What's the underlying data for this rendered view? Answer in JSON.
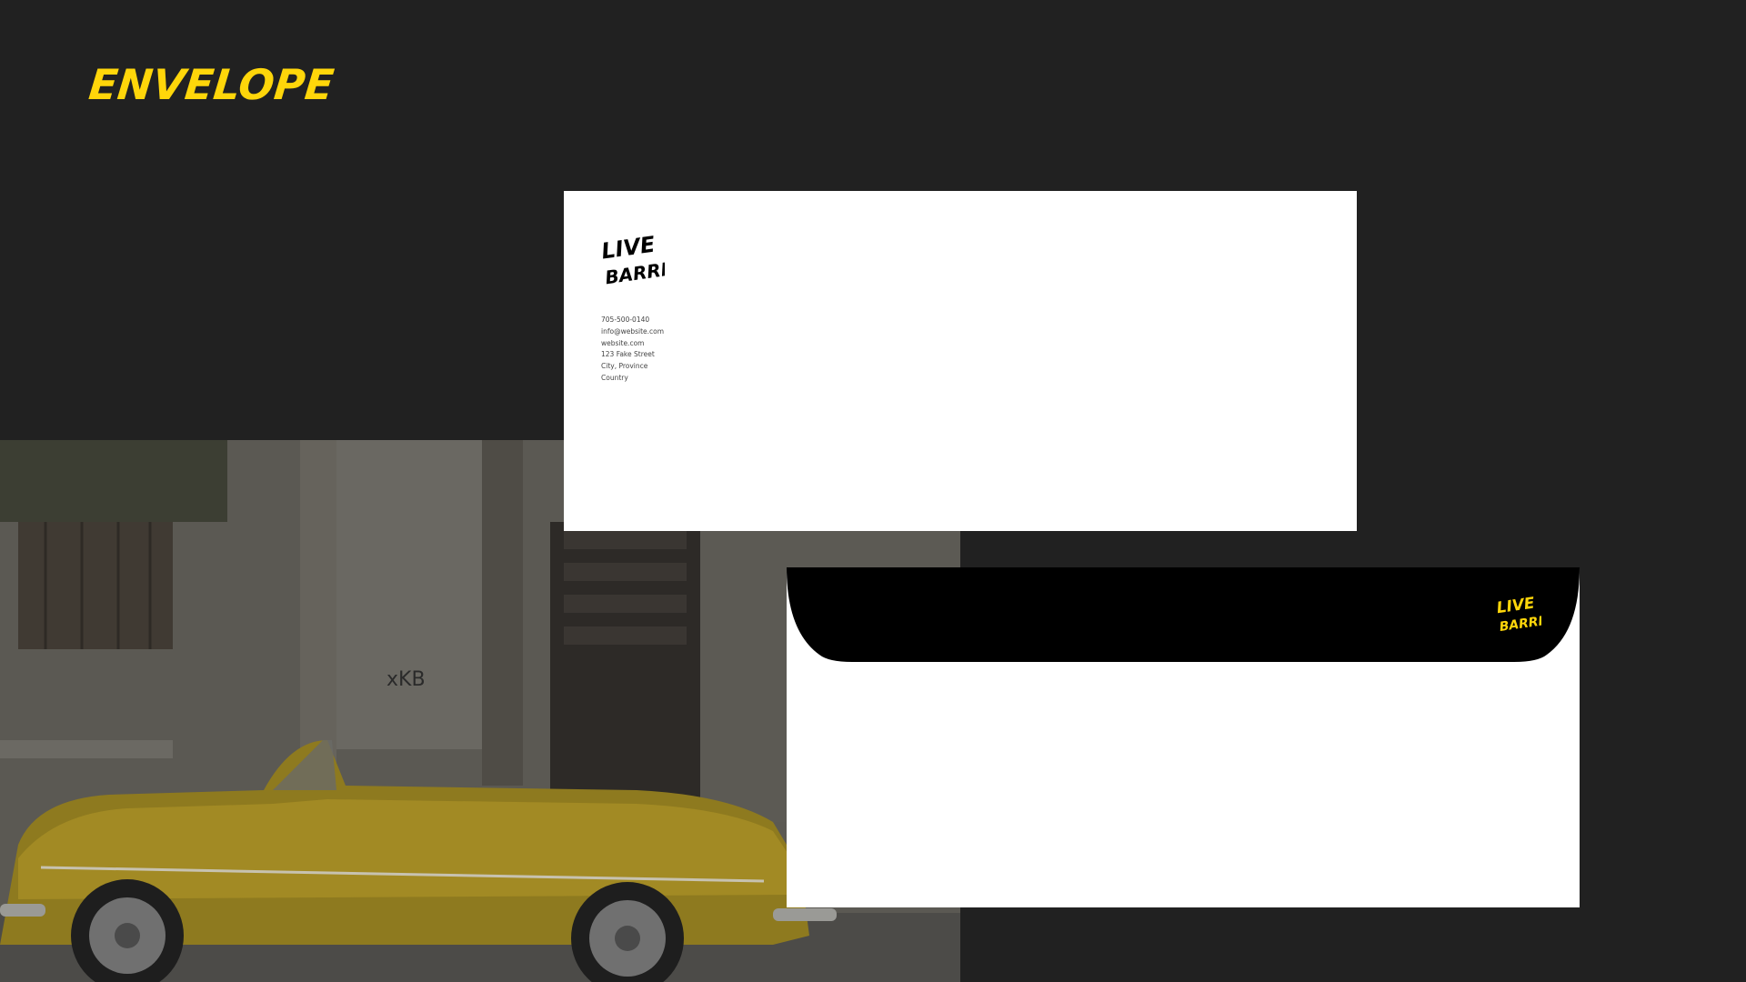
{
  "page": {
    "title": "ENVELOPE"
  },
  "brand": {
    "logo_line1": "LIVE",
    "logo_line2": "BARRIE",
    "accent_color": "#ffd60a",
    "background_color": "#212121"
  },
  "envelope_front": {
    "contact_lines": [
      "705-500-0140",
      "info@website.com",
      "website.com",
      "123 Fake Street",
      "City, Province",
      "Country"
    ]
  },
  "photo": {
    "graffiti_text": "xKB"
  }
}
